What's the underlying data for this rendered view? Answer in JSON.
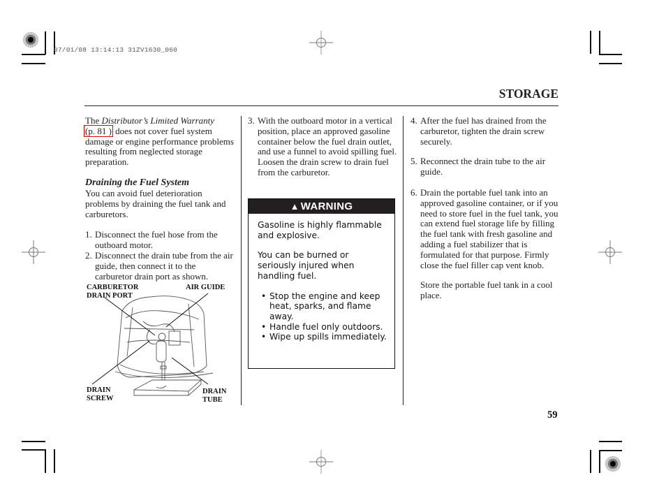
{
  "print_meta": "07/01/08 13:14:13 31ZV1630_060",
  "section_title": "STORAGE",
  "page_number": "59",
  "column1": {
    "intro_prefix": "The ",
    "intro_italic": "Distributor’s Limited Warranty",
    "intro_xref": "(p.  81  )",
    "intro_suffix": " does not cover fuel system damage or engine performance problems resulting from neglected storage preparation.",
    "subheading": "Draining the Fuel System",
    "subintro": "You can avoid fuel deterioration problems by draining the fuel tank and carburetors.",
    "steps": [
      {
        "num": "1.",
        "text": "Disconnect the fuel hose from the outboard motor."
      },
      {
        "num": "2.",
        "text": "Disconnect the drain tube from the air guide, then connect it to the carburetor drain port as shown."
      }
    ],
    "figure_labels": {
      "carburetor_drain_port": "CARBURETOR\nDRAIN PORT",
      "air_guide": "AIR GUIDE",
      "drain_screw": "DRAIN\nSCREW",
      "drain_tube": "DRAIN\nTUBE"
    }
  },
  "column2": {
    "steps": [
      {
        "num": "3.",
        "text": "With the outboard motor in a vertical position, place an approved gasoline container below the fuel drain outlet, and use a funnel to avoid spilling fuel. Loosen the drain screw to drain fuel from the carburetor."
      }
    ],
    "warning": {
      "icon": "warning-triangle-icon",
      "title": "WARNING",
      "para1": "Gasoline is highly flammable and explosive.",
      "para2": "You can be burned or seriously injured when handling fuel.",
      "bullets": [
        "Stop the engine and keep heat, sparks, and flame away.",
        "Handle fuel only outdoors.",
        "Wipe up spills immediately."
      ]
    }
  },
  "column3": {
    "steps": [
      {
        "num": "4.",
        "text": "After the fuel has drained from the carburetor, tighten the drain screw securely."
      },
      {
        "num": "5.",
        "text": "Reconnect the drain tube to the air guide."
      },
      {
        "num": "6.",
        "text": "Drain the portable fuel tank into an approved gasoline container, or if you need to store fuel in the fuel tank, you can extend fuel storage life by filling the fuel tank with fresh gasoline and adding a fuel stabilizer that is formulated for that purpose. Firmly close the fuel filler cap vent knob."
      }
    ],
    "closing": "Store the portable fuel tank in a cool place."
  },
  "colors": {
    "xref_border": "#e00000",
    "warning_header_bg": "#231f20",
    "text": "#222222"
  }
}
